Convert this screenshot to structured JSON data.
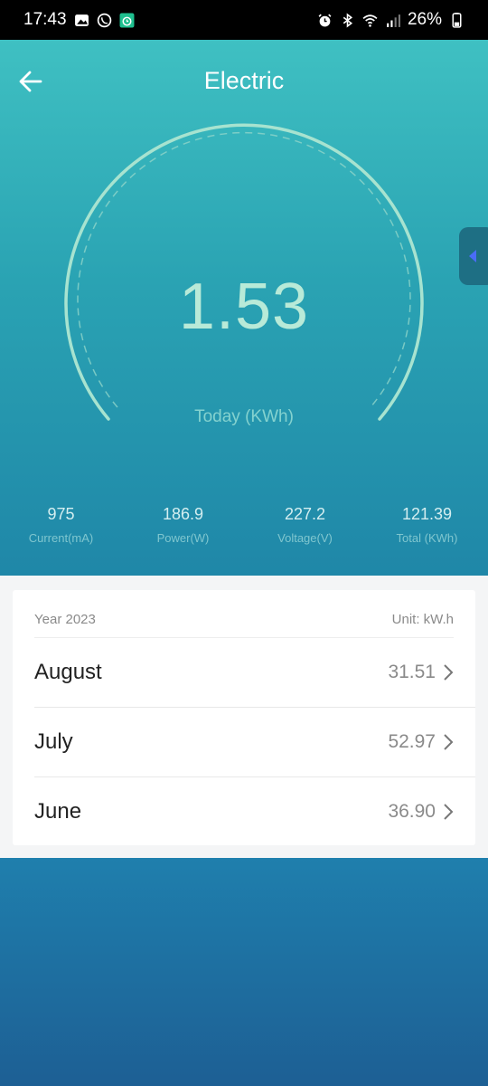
{
  "status_bar": {
    "time": "17:43",
    "battery": "26%",
    "left_icons": [
      "gallery-icon",
      "viber-icon",
      "alarm-app-icon"
    ],
    "right_icons": [
      "alarm-icon",
      "bluetooth-icon",
      "wifi-icon",
      "signal-icon",
      "battery-icon"
    ]
  },
  "header": {
    "title": "Electric",
    "back_icon": "arrow-left-icon"
  },
  "gauge": {
    "value": "1.53",
    "label": "Today (KWh)"
  },
  "stats": [
    {
      "value": "975",
      "label": "Current(mA)"
    },
    {
      "value": "186.9",
      "label": "Power(W)"
    },
    {
      "value": "227.2",
      "label": "Voltage(V)"
    },
    {
      "value": "121.39",
      "label": "Total (KWh)"
    }
  ],
  "history": {
    "year_label": "Year 2023",
    "unit_label": "Unit: kW.h",
    "rows": [
      {
        "month": "August",
        "value": "31.51"
      },
      {
        "month": "July",
        "value": "52.97"
      },
      {
        "month": "June",
        "value": "36.90"
      }
    ]
  },
  "colors": {
    "hero_top": "#3fc0c2",
    "hero_bottom": "#1f87a8",
    "gauge_text": "#b8ead8",
    "side_tab_arrow": "#4a6cf7"
  }
}
